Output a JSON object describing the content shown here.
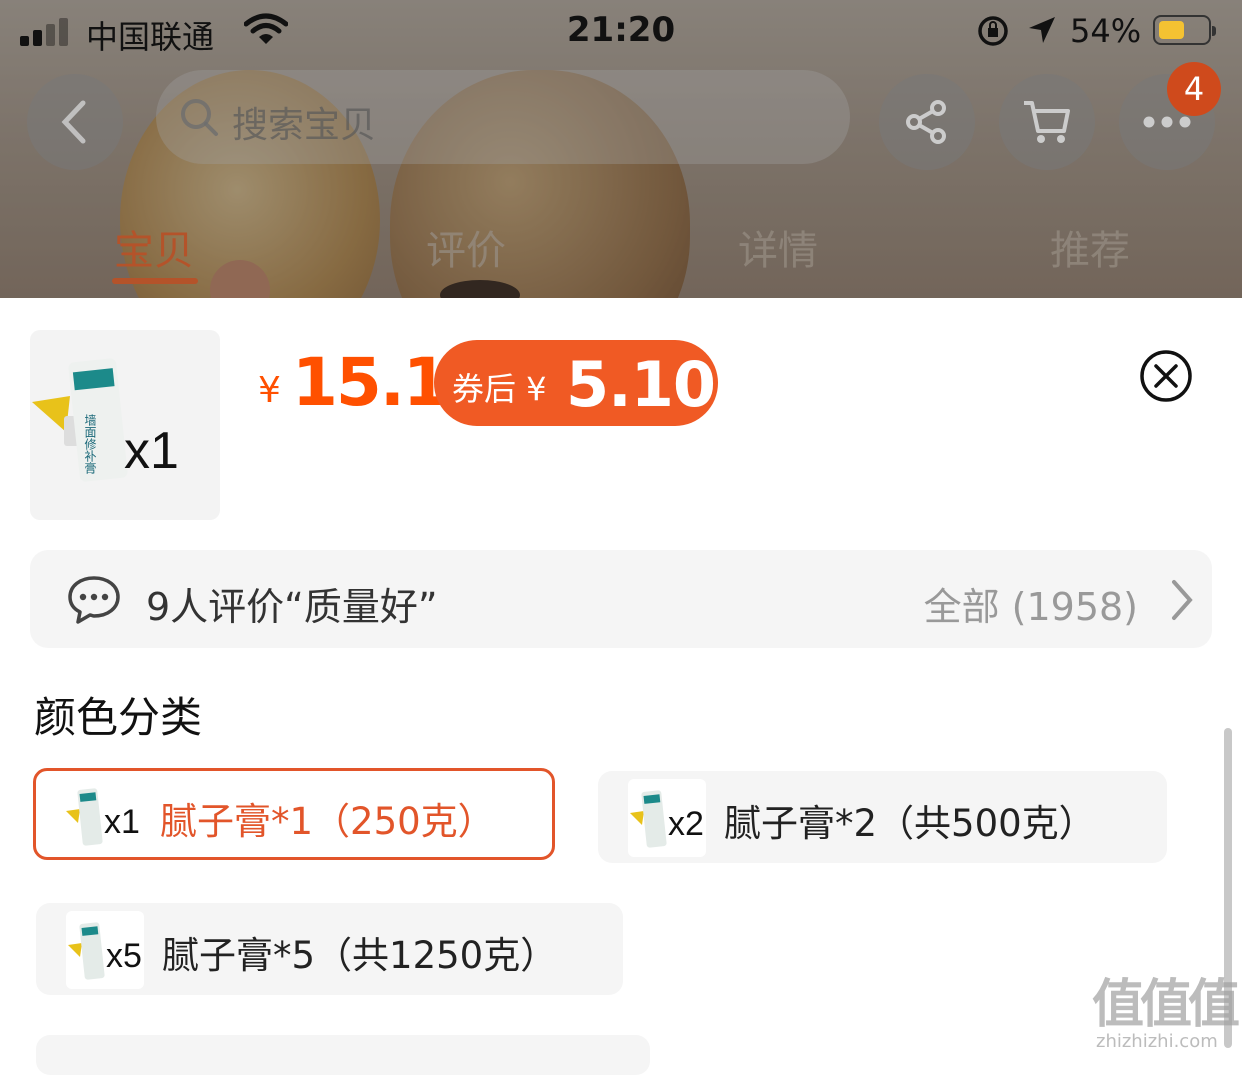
{
  "status_bar": {
    "carrier": "中国联通",
    "time": "21:20",
    "battery_percent": "54%",
    "battery_level": 0.54
  },
  "top_nav": {
    "search_placeholder": "搜索宝贝",
    "badge_count": "4"
  },
  "tabs": [
    {
      "label": "宝贝",
      "active": true
    },
    {
      "label": "评价",
      "active": false
    },
    {
      "label": "详情",
      "active": false
    },
    {
      "label": "推荐",
      "active": false
    }
  ],
  "sheet": {
    "thumb_qty": "x1",
    "currency_symbol": "¥",
    "price": "15.1",
    "coupon_label": "券后 ¥",
    "coupon_price": "5.10",
    "review": {
      "summary": "9人评价“质量好”",
      "all_label": "全部 (1958)"
    },
    "section_title": "颜色分类",
    "options": [
      {
        "qty": "x1",
        "label": "腻子膏*1（250克）",
        "selected": true
      },
      {
        "qty": "x2",
        "label": "腻子膏*2（共500克）",
        "selected": false
      },
      {
        "qty": "x5",
        "label": "腻子膏*5（共1250克）",
        "selected": false
      }
    ]
  },
  "product_image_text": "墙面修补膏",
  "watermark": {
    "main": "值值值",
    "sub": "zhizhizhi.com"
  },
  "colors": {
    "accent": "#ff5000",
    "coupon_bg": "#f05a24",
    "selected_border": "#e2552a",
    "badge": "#cf4a1c"
  }
}
